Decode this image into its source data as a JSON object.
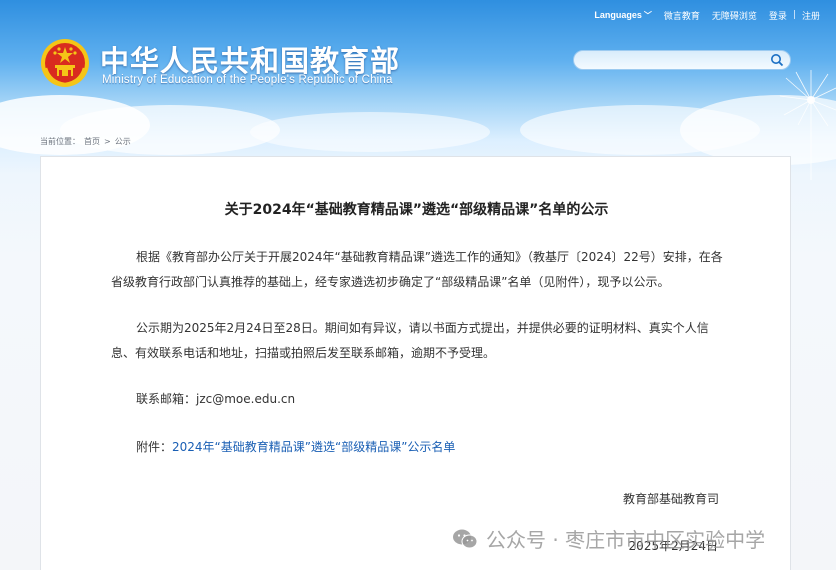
{
  "topbar": {
    "languages": "Languages",
    "weibo": "微言教育",
    "accessible": "无障碍浏览",
    "login": "登录",
    "separator": "|",
    "register": "注册"
  },
  "header": {
    "title_cn": "中华人民共和国教育部",
    "title_en": "Ministry of Education of the People's Republic of China"
  },
  "search": {
    "value": "",
    "placeholder": ""
  },
  "breadcrumb": {
    "prefix": "当前位置：",
    "home": "首页",
    "sep": ">",
    "current": "公示"
  },
  "article": {
    "title": "关于2024年“基础教育精品课”遴选“部级精品课”名单的公示",
    "p1": "根据《教育部办公厅关于开展2024年“基础教育精品课”遴选工作的通知》（教基厅〔2024〕22号）安排，在各省级教育行政部门认真推荐的基础上，经专家遴选初步确定了“部级精品课”名单（见附件），现予以公示。",
    "p2": "公示期为2025年2月24日至28日。期间如有异议，请以书面方式提出，并提供必要的证明材料、真实个人信息、有效联系电话和地址，扫描或拍照后发至联系邮箱，逾期不予受理。",
    "email_label": "联系邮箱：",
    "email": "jzc@moe.edu.cn",
    "attachment_label": "附件：",
    "attachment_link": "2024年“基础教育精品课”遴选“部级精品课”公示名单",
    "signature": "教育部基础教育司",
    "date": "2025年2月24日"
  },
  "watermark": {
    "text": "公众号 · 枣庄市市中区实验中学"
  },
  "colors": {
    "header_blue": "#2f8fe0",
    "link_blue": "#1a5fb4",
    "emblem_red": "#d92b1f",
    "emblem_gold": "#f5c517"
  }
}
